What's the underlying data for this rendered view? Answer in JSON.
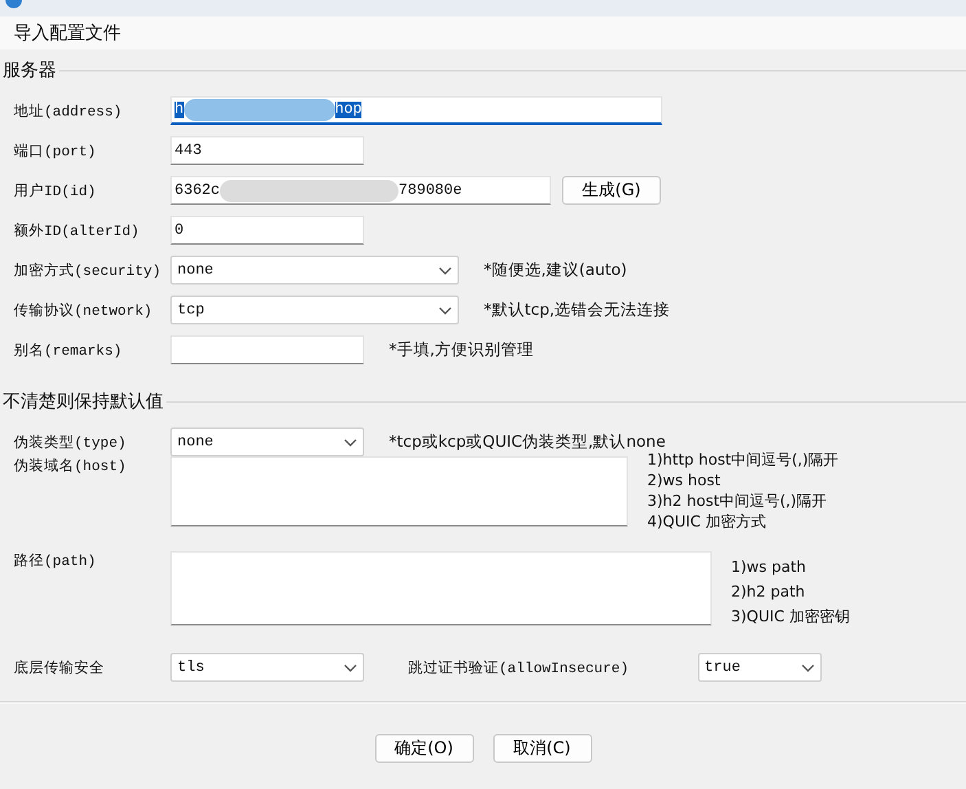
{
  "menu": {
    "items": [
      {
        "label": "导入配置文件"
      }
    ]
  },
  "server": {
    "legend": "服务器",
    "fields": [
      {
        "kind": "input",
        "label": "地址(address)",
        "value_parts": [
          "h",
          "hop"
        ],
        "redacted": true,
        "focused": true
      },
      {
        "kind": "input",
        "label": "端口(port)",
        "value_parts": [
          "443"
        ],
        "focused": false
      },
      {
        "kind": "input",
        "label": "用户ID(id)",
        "value_parts": [
          "6362c",
          "789080e"
        ],
        "redacted": true,
        "focused": false,
        "button": "生成(G)"
      },
      {
        "kind": "input",
        "label": "额外ID(alterId)",
        "value_parts": [
          "0"
        ],
        "focused": false
      },
      {
        "kind": "select",
        "label": "加密方式(security)",
        "value": "none",
        "hint": "*随便选,建议(auto)"
      },
      {
        "kind": "select",
        "label": "传输协议(network)",
        "value": "tcp",
        "hint": "*默认tcp,选错会无法连接"
      },
      {
        "kind": "input",
        "label": "别名(remarks)",
        "focused": false,
        "hint": "*手填,方便识别管理"
      }
    ]
  },
  "advanced": {
    "legend": "不清楚则保持默认值",
    "type": {
      "label": "伪装类型(type)",
      "value": "none",
      "hint": "*tcp或kcp或QUIC伪装类型,默认none"
    },
    "host": {
      "label": "伪装域名(host)",
      "notes": [
        "1)http host中间逗号(,)隔开",
        "2)ws host",
        "3)h2 host中间逗号(,)隔开",
        "4)QUIC 加密方式"
      ]
    },
    "path": {
      "label": "路径(path)",
      "notes": [
        "1)ws path",
        "2)h2 path",
        "3)QUIC 加密密钥"
      ]
    },
    "tls": {
      "label": "底层传输安全",
      "value": "tls"
    },
    "insecure": {
      "label": "跳过证书验证(allowInsecure)",
      "value": "true"
    }
  },
  "buttons": [
    {
      "label": "确定(O)"
    },
    {
      "label": "取消(C)"
    }
  ]
}
